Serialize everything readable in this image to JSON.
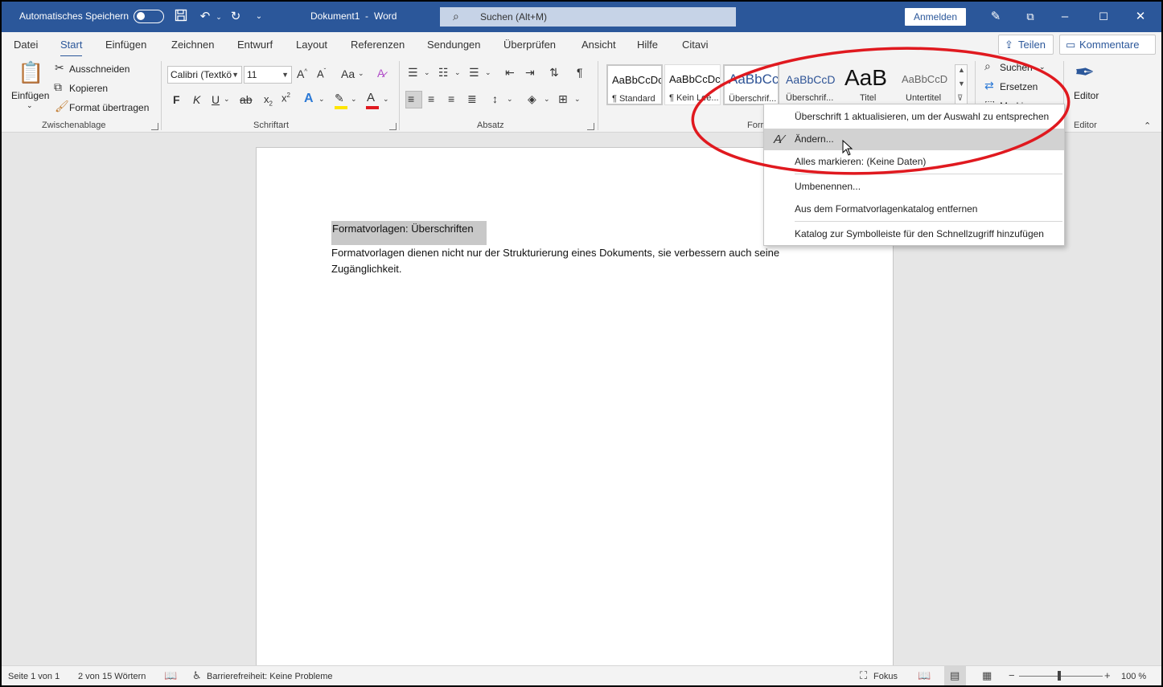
{
  "titlebar": {
    "autosave_label": "Automatisches Speichern",
    "doc_title": "Dokument1",
    "separator": "-",
    "app_name": "Word",
    "search_placeholder": "Suchen (Alt+M)",
    "signin_label": "Anmelden"
  },
  "tabs": [
    "Datei",
    "Start",
    "Einfügen",
    "Zeichnen",
    "Entwurf",
    "Layout",
    "Referenzen",
    "Sendungen",
    "Überprüfen",
    "Ansicht",
    "Hilfe",
    "Citavi"
  ],
  "share_label": "Teilen",
  "comments_label": "Kommentare",
  "clipboard": {
    "paste_label": "Einfügen",
    "cut_label": "Ausschneiden",
    "copy_label": "Kopieren",
    "format_painter_label": "Format übertragen",
    "group_label": "Zwischenablage"
  },
  "font": {
    "font_name": "Calibri (Textkö",
    "font_size": "11",
    "bold": "F",
    "italic": "K",
    "underline": "U",
    "strike": "ab",
    "group_label": "Schriftart"
  },
  "paragraph": {
    "group_label": "Absatz"
  },
  "styles": {
    "tiles": [
      {
        "preview": "AaBbCcDc",
        "name": "¶ Standard"
      },
      {
        "preview": "AaBbCcDc",
        "name": "¶ Kein Lee..."
      },
      {
        "preview": "AaBbCc",
        "name": "Überschrif..."
      },
      {
        "preview": "AaBbCcD",
        "name": "Überschrif..."
      },
      {
        "preview": "AaB",
        "name": "Titel"
      },
      {
        "preview": "AaBbCcD",
        "name": "Untertitel"
      }
    ],
    "group_label": "Forr"
  },
  "editing": {
    "find_label": "Suchen",
    "replace_label": "Ersetzen",
    "select_label": "Markieren"
  },
  "editor": {
    "label": "Editor",
    "group_label": "Editor"
  },
  "document": {
    "heading": "Formatvorlagen: Überschriften",
    "paragraph": "Formatvorlagen dienen nicht nur der Strukturierung eines Dokuments, sie verbessern auch seine Zugänglichkeit."
  },
  "context_menu": {
    "items": [
      "Überschrift 1 aktualisieren, um der Auswahl zu entsprechen",
      "Ändern...",
      "Alles markieren: (Keine Daten)",
      "Umbenennen...",
      "Aus dem Formatvorlagenkatalog entfernen",
      "Katalog zur Symbolleiste für den Schnellzugriff hinzufügen"
    ]
  },
  "statusbar": {
    "page": "Seite 1 von 1",
    "words": "2 von 15 Wörtern",
    "accessibility": "Barrierefreiheit: Keine Probleme",
    "focus": "Fokus",
    "zoom": "100 %"
  },
  "colors": {
    "accent": "#2b579a",
    "annotation": "#e0191f",
    "highlight_yellow": "#ffe500",
    "font_color_red": "#e0191f"
  }
}
